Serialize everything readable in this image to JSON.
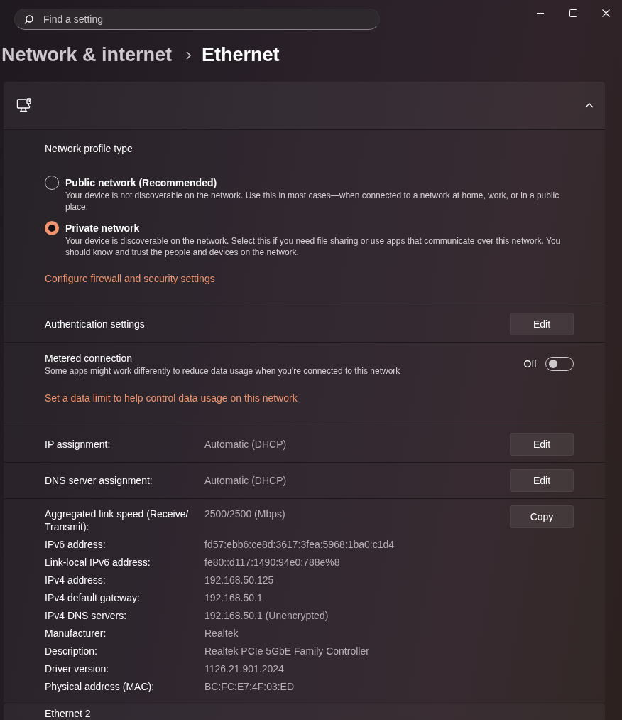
{
  "search": {
    "placeholder": "Find a setting"
  },
  "breadcrumb": [
    {
      "label": "Network & internet",
      "current": false
    },
    {
      "label": "Ethernet",
      "current": true
    }
  ],
  "adapter": {
    "expanded": true,
    "profile": {
      "heading": "Network profile type",
      "options": [
        {
          "label": "Public network (Recommended)",
          "description": "Your device is not discoverable on the network. Use this in most cases—when connected to a network at home, work, or in a public place.",
          "selected": false
        },
        {
          "label": "Private network",
          "description": "Your device is discoverable on the network. Select this if you need file sharing or use apps that communicate over this network. You should know and trust the people and devices on the network.",
          "selected": true
        }
      ],
      "link": "Configure firewall and security settings"
    },
    "authentication": {
      "label": "Authentication settings",
      "button": "Edit"
    },
    "metered": {
      "label": "Metered connection",
      "description": "Some apps might work differently to reduce data usage when you're connected to this network",
      "state_label": "Off",
      "on": false,
      "link": "Set a data limit to help control data usage on this network"
    },
    "assignments": [
      {
        "label": "IP assignment:",
        "value": "Automatic (DHCP)",
        "button": "Edit"
      },
      {
        "label": "DNS server assignment:",
        "value": "Automatic (DHCP)",
        "button": "Edit"
      }
    ],
    "details": {
      "button": "Copy",
      "rows": [
        {
          "label": "Aggregated link speed (Receive/ Transmit):",
          "value": "2500/2500 (Mbps)"
        },
        {
          "label": "IPv6 address:",
          "value": "fd57:ebb6:ce8d:3617:3fea:5968:1ba0:c1d4"
        },
        {
          "label": "Link-local IPv6 address:",
          "value": "fe80::d117:1490:94e0:788e%8"
        },
        {
          "label": "IPv4 address:",
          "value": "192.168.50.125"
        },
        {
          "label": "IPv4 default gateway:",
          "value": "192.168.50.1"
        },
        {
          "label": "IPv4 DNS servers:",
          "value": "192.168.50.1 (Unencrypted)"
        },
        {
          "label": "Manufacturer:",
          "value": "Realtek"
        },
        {
          "label": "Description:",
          "value": "Realtek PCIe 5GbE Family Controller"
        },
        {
          "label": "Driver version:",
          "value": "1126.21.901.2024"
        },
        {
          "label": "Physical address (MAC):",
          "value": "BC:FC:E7:4F:03:ED"
        }
      ]
    }
  },
  "next_adapter": {
    "title": "Ethernet 2"
  }
}
